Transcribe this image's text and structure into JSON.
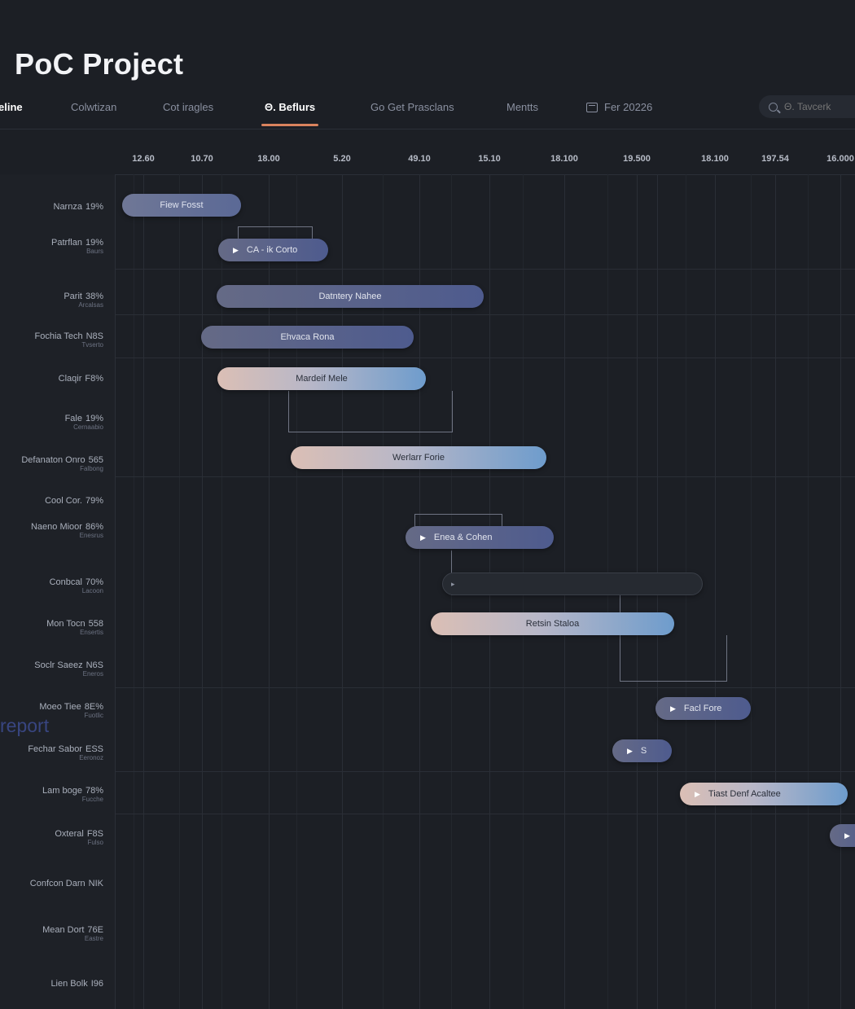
{
  "header": {
    "title": "PoC Project"
  },
  "tabs": [
    {
      "label": "eline",
      "active": false
    },
    {
      "label": "Colwtizan",
      "active": false
    },
    {
      "label": "Cot iragles",
      "active": false
    },
    {
      "label": "Θ. Beflurs",
      "active": true
    },
    {
      "label": "Go Get Prasclans",
      "active": false
    },
    {
      "label": "Mentts",
      "active": false
    },
    {
      "label": "Fer 20226",
      "active": false,
      "icon": "calendar-icon"
    }
  ],
  "search": {
    "placeholder": "Θ. Tavcerk",
    "icon": "search-icon"
  },
  "timeline": {
    "ticks": [
      "12.60",
      "10.70",
      "18.00",
      "5.20",
      "49.10",
      "15.10",
      "18.100",
      "19.500",
      "18.100",
      "197.54",
      "16.000"
    ]
  },
  "rows": [
    {
      "label": "Narnza",
      "pct": "19%",
      "sub": ""
    },
    {
      "label": "Patrflan",
      "pct": "19%",
      "sub": "Baurs"
    },
    {
      "label": "Parit",
      "pct": "38%",
      "sub": "Arcalsas"
    },
    {
      "label": "Fochia Tech",
      "pct": "N8S",
      "sub": "Tvserto"
    },
    {
      "label": "Claqir",
      "pct": "F8%",
      "sub": ""
    },
    {
      "label": "Fale",
      "pct": "19%",
      "sub": "Cernaabio"
    },
    {
      "label": "Defanaton Onro",
      "pct": "565",
      "sub": "Falbong"
    },
    {
      "label": "Cool Cor.",
      "pct": "79%",
      "sub": ""
    },
    {
      "label": "Naeno Mioor",
      "pct": "86%",
      "sub": "Enesrus"
    },
    {
      "label": "Conbcal",
      "pct": "70%",
      "sub": "Lacoon"
    },
    {
      "label": "Mon Tocn",
      "pct": "558",
      "sub": "Ensertis"
    },
    {
      "label": "Soclr Saeez",
      "pct": "N6S",
      "sub": "Eneros"
    },
    {
      "label": "Moeo Tiee",
      "pct": "8E%",
      "sub": "Fuotlic"
    },
    {
      "label": "Fechar Sabor",
      "pct": "ESS",
      "sub": "Eeronoz"
    },
    {
      "label": "Lam boge",
      "pct": "78%",
      "sub": "Fucche"
    },
    {
      "label": "Oxteral",
      "pct": "F8S",
      "sub": "Fulso"
    },
    {
      "label": "Confcon Darn",
      "pct": "NIK",
      "sub": ""
    },
    {
      "label": "Mean Dort",
      "pct": "76E",
      "sub": "Eastre"
    },
    {
      "label": "Lien Bolk",
      "pct": "I96",
      "sub": ""
    }
  ],
  "bars": [
    {
      "label": "Fiew Fosst"
    },
    {
      "label": "CA - ik Corto",
      "icon": "play-icon"
    },
    {
      "label": "Datntery Nahee"
    },
    {
      "label": "Ehvaca Rona"
    },
    {
      "label": "Mardeif Mele"
    },
    {
      "label": "Werlarr Forie"
    },
    {
      "label": "Enea & Cohen",
      "icon": "play-icon"
    },
    {
      "label": "",
      "icon": "play-icon"
    },
    {
      "label": "Retsin Staloa"
    },
    {
      "label": "Facl Fore",
      "icon": "play-icon"
    },
    {
      "label": "S",
      "icon": "play-icon"
    },
    {
      "label": "Tiast Denf Acaltee",
      "icon": "play-icon"
    },
    {
      "label": "",
      "icon": "play-icon"
    }
  ],
  "watermark": "report",
  "colors": {
    "background": "#1c1f25",
    "accent": "#d9835e",
    "bar_blue": "#5b6996",
    "bar_warm": "#dbbfb5"
  }
}
